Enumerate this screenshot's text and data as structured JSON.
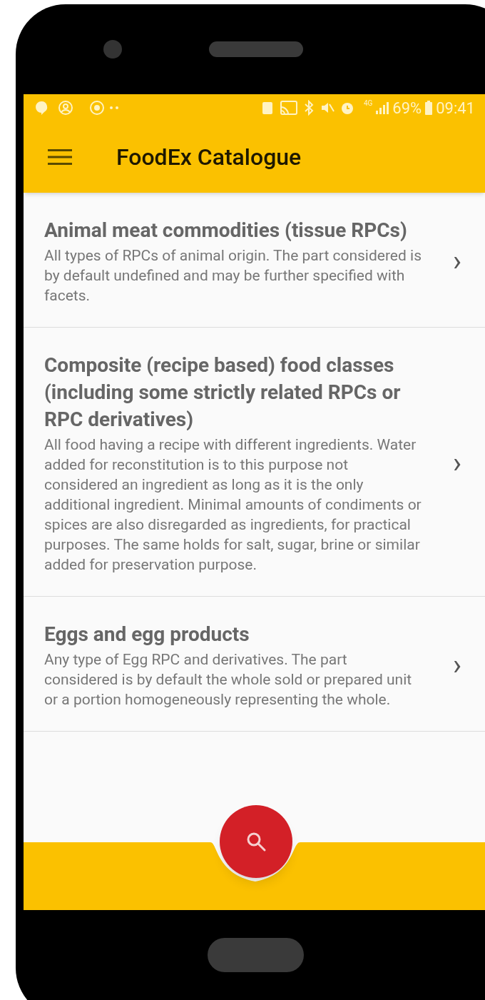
{
  "status_bar": {
    "signal_label": "4G",
    "battery": "69%",
    "time": "09:41"
  },
  "app_bar": {
    "title": "FoodEx Catalogue"
  },
  "items": [
    {
      "title": "Animal meat commodities (tissue RPCs)",
      "description": "All types of RPCs of animal origin. The part considered is by default undefined and may be further specified with facets.",
      "chevron": "›"
    },
    {
      "title": "Composite (recipe based) food classes (including some strictly related RPCs or RPC derivatives)",
      "description": "All food having a recipe with different ingredients. Water added for reconstitution is to this purpose not considered an ingredient as long as it is the only additional ingredient. Minimal amounts of condiments or spices are also disregarded as ingredients, for practical purposes. The same holds for salt, sugar, brine or similar added for preservation purpose.",
      "chevron": "›"
    },
    {
      "title": "Eggs and egg products",
      "description": "Any type of Egg RPC and derivatives. The part considered is by default the whole sold or prepared unit or a portion homogeneously representing the whole.",
      "chevron": "›"
    }
  ]
}
